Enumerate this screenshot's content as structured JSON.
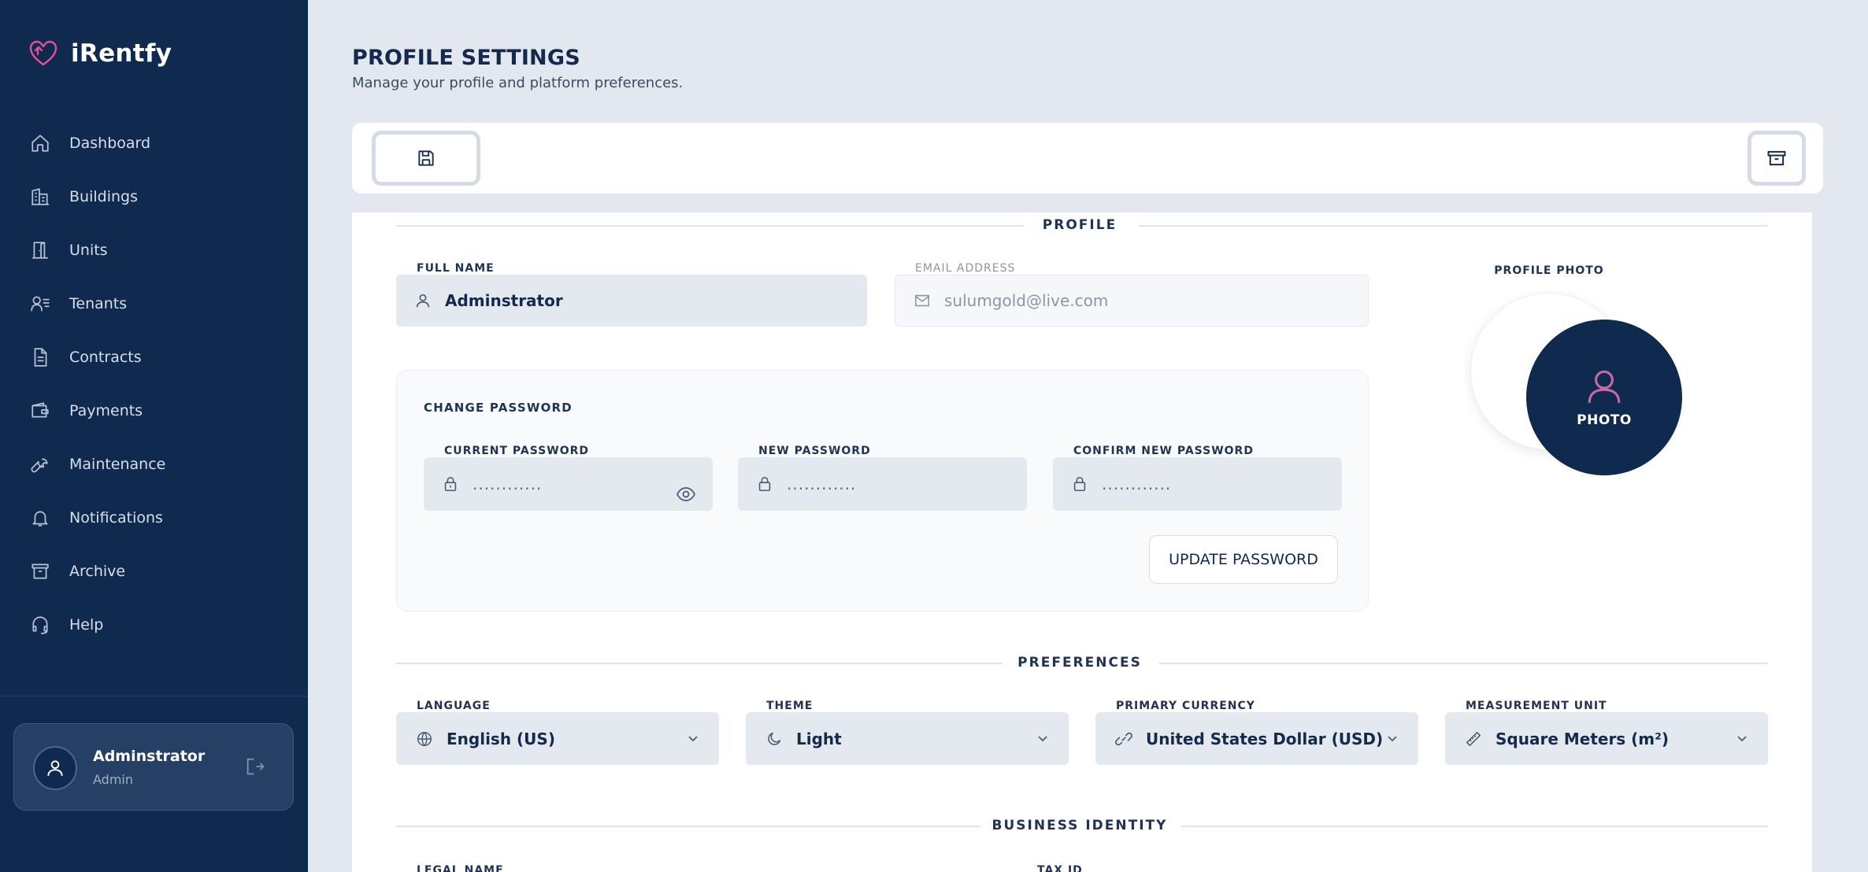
{
  "app": {
    "name": "iRentfy"
  },
  "sidebar": {
    "items": [
      {
        "label": "Dashboard",
        "icon": "home-icon"
      },
      {
        "label": "Buildings",
        "icon": "buildings-icon"
      },
      {
        "label": "Units",
        "icon": "door-icon"
      },
      {
        "label": "Tenants",
        "icon": "users-list-icon"
      },
      {
        "label": "Contracts",
        "icon": "document-icon"
      },
      {
        "label": "Payments",
        "icon": "wallet-icon"
      },
      {
        "label": "Maintenance",
        "icon": "wrench-icon"
      },
      {
        "label": "Notifications",
        "icon": "bell-icon"
      },
      {
        "label": "Archive",
        "icon": "archive-icon"
      },
      {
        "label": "Help",
        "icon": "headset-icon"
      }
    ],
    "user": {
      "name": "Adminstrator",
      "role": "Admin"
    }
  },
  "header": {
    "title": "PROFILE SETTINGS",
    "subtitle": "Manage your profile and platform preferences."
  },
  "profile": {
    "section_title": "PROFILE",
    "full_name": {
      "label": "FULL NAME",
      "value": "Adminstrator"
    },
    "email": {
      "label": "EMAIL ADDRESS",
      "value": "sulumgold@live.com"
    },
    "photo": {
      "label": "PROFILE PHOTO",
      "button": "PHOTO"
    }
  },
  "password": {
    "title": "CHANGE PASSWORD",
    "current": {
      "label": "CURRENT PASSWORD",
      "value": "............"
    },
    "new": {
      "label": "NEW PASSWORD",
      "value": "............"
    },
    "confirm": {
      "label": "CONFIRM NEW PASSWORD",
      "value": "............"
    },
    "update_button": "UPDATE PASSWORD"
  },
  "preferences": {
    "section_title": "PREFERENCES",
    "language": {
      "label": "LANGUAGE",
      "value": "English (US)"
    },
    "theme": {
      "label": "THEME",
      "value": "Light"
    },
    "currency": {
      "label": "PRIMARY CURRENCY",
      "value": "United States Dollar (USD)"
    },
    "unit": {
      "label": "MEASUREMENT UNIT",
      "value": "Square Meters (m²)"
    }
  },
  "business": {
    "section_title": "BUSINESS IDENTITY",
    "legal_name": {
      "label": "LEGAL NAME"
    },
    "tax_id": {
      "label": "TAX ID"
    }
  },
  "colors": {
    "sidebar_bg": "#10294f",
    "page_bg": "#e3e8f0",
    "accent": "#e0529c",
    "text": "#142a4c"
  }
}
